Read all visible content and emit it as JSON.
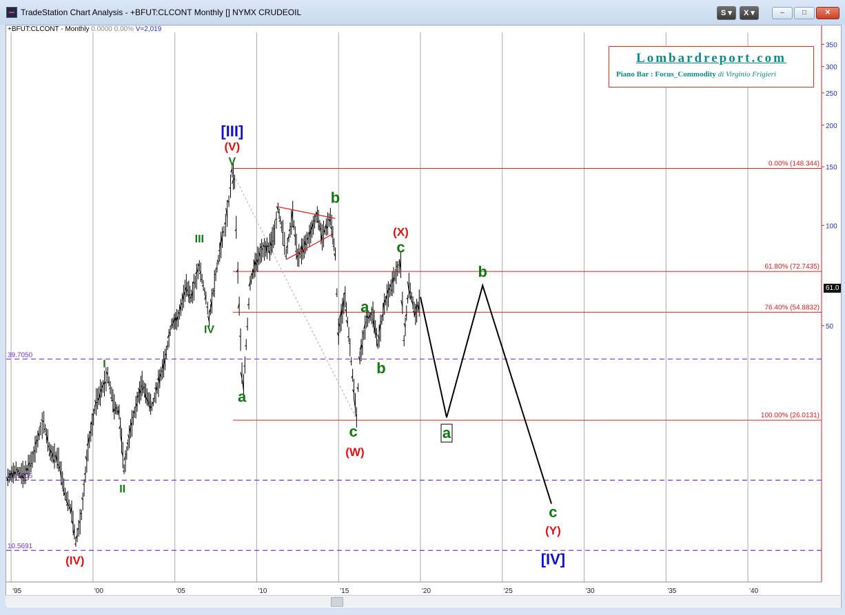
{
  "window": {
    "title": "TradeStation Chart Analysis - +BFUT:CLCONT Monthly [] NYMX CRUDEOIL",
    "btn_s": "S",
    "btn_x": "X",
    "btn_min": "–",
    "btn_max": "□",
    "btn_close": "✕"
  },
  "symbol_line": {
    "symbol": "+BFUT:CLCONT - Monthly",
    "change": "0.0000",
    "pct": "0.00%",
    "volume": "V=2,019"
  },
  "logo": {
    "title": "Lombardreport.com",
    "subtitle": "Piano Bar : Focus_Commodity",
    "author": "di Virginio Frigieri"
  },
  "last_price": "61.0",
  "chart_data": {
    "type": "line",
    "y_scale": "log",
    "ylim": [
      8.5,
      380
    ],
    "xlim": [
      1994.7,
      2044.5
    ],
    "x_ticks": [
      {
        "x": 1995,
        "label": "'95"
      },
      {
        "x": 2000,
        "label": "'00"
      },
      {
        "x": 2005,
        "label": "'05"
      },
      {
        "x": 2010,
        "label": "'10"
      },
      {
        "x": 2015,
        "label": "'15"
      },
      {
        "x": 2020,
        "label": "'20"
      },
      {
        "x": 2025,
        "label": "'25"
      },
      {
        "x": 2030,
        "label": "'30"
      },
      {
        "x": 2035,
        "label": "'35"
      },
      {
        "x": 2040,
        "label": "'40"
      }
    ],
    "y_ticks": [
      {
        "v": 350,
        "label": "350"
      },
      {
        "v": 300,
        "label": "300"
      },
      {
        "v": 250,
        "label": "250"
      },
      {
        "v": 200,
        "label": "200"
      },
      {
        "v": 150,
        "label": "150"
      },
      {
        "v": 100,
        "label": "100"
      },
      {
        "v": 50,
        "label": "50"
      }
    ],
    "price_series": [
      [
        1994.8,
        17.5
      ],
      [
        1995.3,
        18.3
      ],
      [
        1995.8,
        17.8
      ],
      [
        1996.3,
        19.8
      ],
      [
        1996.8,
        24.5
      ],
      [
        1997.0,
        25.6
      ],
      [
        1997.4,
        20.8
      ],
      [
        1997.9,
        19.8
      ],
      [
        1998.3,
        15.6
      ],
      [
        1998.7,
        13.8
      ],
      [
        1998.95,
        11.2
      ],
      [
        1999.3,
        13.5
      ],
      [
        1999.7,
        21.5
      ],
      [
        2000.2,
        29.5
      ],
      [
        2000.7,
        33.5
      ],
      [
        2000.9,
        35.5
      ],
      [
        2001.3,
        28.5
      ],
      [
        2001.6,
        27.5
      ],
      [
        2001.9,
        18.5
      ],
      [
        2002.3,
        24.5
      ],
      [
        2002.7,
        29.5
      ],
      [
        2003.0,
        33.5
      ],
      [
        2003.3,
        30.5
      ],
      [
        2003.6,
        28.5
      ],
      [
        2004.0,
        33.5
      ],
      [
        2004.4,
        39.5
      ],
      [
        2004.8,
        50.5
      ],
      [
        2005.2,
        52.5
      ],
      [
        2005.7,
        66.0
      ],
      [
        2006.0,
        60.5
      ],
      [
        2006.5,
        75.5
      ],
      [
        2006.9,
        60.5
      ],
      [
        2007.1,
        52.5
      ],
      [
        2007.5,
        71.0
      ],
      [
        2007.9,
        92.0
      ],
      [
        2008.1,
        100.0
      ],
      [
        2008.3,
        118.0
      ],
      [
        2008.5,
        145.5
      ],
      [
        2008.65,
        135.0
      ],
      [
        2008.85,
        72.0
      ],
      [
        2009.1,
        36.0
      ],
      [
        2009.2,
        33.0
      ],
      [
        2009.6,
        67.0
      ],
      [
        2009.9,
        76.0
      ],
      [
        2010.3,
        84.0
      ],
      [
        2010.8,
        86.0
      ],
      [
        2011.1,
        95.0
      ],
      [
        2011.3,
        113.0
      ],
      [
        2011.6,
        95.0
      ],
      [
        2011.8,
        82.0
      ],
      [
        2012.2,
        108.0
      ],
      [
        2012.5,
        80.0
      ],
      [
        2012.9,
        86.0
      ],
      [
        2013.3,
        95.0
      ],
      [
        2013.7,
        108.0
      ],
      [
        2014.0,
        92.0
      ],
      [
        2014.5,
        106.0
      ],
      [
        2014.8,
        82.0
      ],
      [
        2015.0,
        48.0
      ],
      [
        2015.4,
        61.0
      ],
      [
        2015.7,
        43.0
      ],
      [
        2016.1,
        26.5
      ],
      [
        2016.3,
        40.0
      ],
      [
        2016.7,
        52.0
      ],
      [
        2017.1,
        54.0
      ],
      [
        2017.4,
        44.0
      ],
      [
        2017.8,
        58.0
      ],
      [
        2018.2,
        65.0
      ],
      [
        2018.6,
        74.0
      ],
      [
        2018.8,
        76.0
      ],
      [
        2019.0,
        45.0
      ],
      [
        2019.3,
        66.0
      ],
      [
        2019.7,
        54.0
      ],
      [
        2020.0,
        60.0
      ]
    ],
    "projection": [
      [
        2020.0,
        61.0
      ],
      [
        2021.6,
        26.5
      ],
      [
        2023.8,
        66.0
      ],
      [
        2028.0,
        14.6
      ]
    ],
    "fib_levels": [
      {
        "label": "0.00% (148.344)",
        "price": 148.344
      },
      {
        "label": "61.80% (72.7435)",
        "price": 72.7435
      },
      {
        "label": "76.40% (54.8832)",
        "price": 54.8832
      },
      {
        "label": "100.00% (26.0131)",
        "price": 26.0131
      }
    ],
    "fib_start_x": 2008.55,
    "horizontal_levels": [
      {
        "label": "39.7050",
        "price": 39.705
      },
      {
        "label": "17.1806",
        "price": 17.1806
      },
      {
        "label": "10.5691",
        "price": 10.5691
      }
    ],
    "triangle_upper": [
      [
        2011.2,
        114.0
      ],
      [
        2014.8,
        105.0
      ]
    ],
    "triangle_lower": [
      [
        2011.8,
        79.0
      ],
      [
        2014.6,
        94.0
      ]
    ],
    "trend_dotted": [
      [
        2008.5,
        145.0
      ],
      [
        2016.1,
        26.2
      ]
    ],
    "wave_labels": [
      {
        "text": "[III]",
        "x": 2008.5,
        "y": 185,
        "color": "#1111cc",
        "size": 22
      },
      {
        "text": "(V)",
        "x": 2008.5,
        "y": 168,
        "color": "#dd1111",
        "size": 17
      },
      {
        "text": "V",
        "x": 2008.5,
        "y": 152,
        "color": "#117711",
        "size": 16
      },
      {
        "text": "III",
        "x": 2006.5,
        "y": 89,
        "color": "#117711",
        "size": 16
      },
      {
        "text": "IV",
        "x": 2007.1,
        "y": 47.5,
        "color": "#117711",
        "size": 16
      },
      {
        "text": "I",
        "x": 2000.7,
        "y": 37.5,
        "color": "#117711",
        "size": 16
      },
      {
        "text": "II",
        "x": 2001.8,
        "y": 15.8,
        "color": "#117711",
        "size": 16
      },
      {
        "text": "(IV)",
        "x": 1998.9,
        "y": 9.6,
        "color": "#dd1111",
        "size": 17
      },
      {
        "text": "a",
        "x": 2009.1,
        "y": 29.5,
        "color": "#117711",
        "size": 22
      },
      {
        "text": "b",
        "x": 2014.8,
        "y": 117,
        "color": "#117711",
        "size": 22
      },
      {
        "text": "a",
        "x": 2016.6,
        "y": 55,
        "color": "#117711",
        "size": 22
      },
      {
        "text": "b",
        "x": 2017.6,
        "y": 36,
        "color": "#117711",
        "size": 22
      },
      {
        "text": "c",
        "x": 2015.9,
        "y": 23.2,
        "color": "#117711",
        "size": 22
      },
      {
        "text": "(W)",
        "x": 2016.0,
        "y": 20.3,
        "color": "#dd1111",
        "size": 17
      },
      {
        "text": "(X)",
        "x": 2018.8,
        "y": 93,
        "color": "#dd1111",
        "size": 17
      },
      {
        "text": "c",
        "x": 2018.8,
        "y": 83,
        "color": "#117711",
        "size": 22
      },
      {
        "text": "b",
        "x": 2023.8,
        "y": 70,
        "color": "#117711",
        "size": 22
      },
      {
        "text": "a",
        "x": 2021.6,
        "y": 23.0,
        "color": "#117711",
        "size": 22,
        "boxed": true
      },
      {
        "text": "c",
        "x": 2028.1,
        "y": 13.3,
        "color": "#117711",
        "size": 22
      },
      {
        "text": "(Y)",
        "x": 2028.1,
        "y": 11.8,
        "color": "#dd1111",
        "size": 17
      },
      {
        "text": "[IV]",
        "x": 2028.1,
        "y": 9.6,
        "color": "#1111cc",
        "size": 22
      }
    ]
  }
}
